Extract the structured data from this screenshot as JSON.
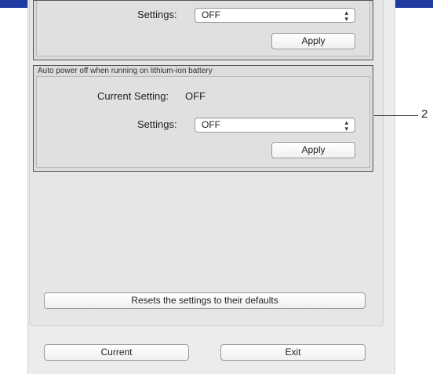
{
  "group1": {
    "settings_label": "Settings:",
    "settings_value": "OFF",
    "apply_label": "Apply"
  },
  "group2": {
    "title": "Auto power off when running on lithium-ion battery",
    "current_setting_label": "Current Setting:",
    "current_setting_value": "OFF",
    "settings_label": "Settings:",
    "settings_value": "OFF",
    "apply_label": "Apply"
  },
  "reset_button_label": "Resets the settings to their defaults",
  "footer": {
    "current_label": "Current",
    "exit_label": "Exit"
  },
  "callout": "2",
  "colors": {
    "title_bar": "#1f3aa0",
    "group_border": "#555555"
  }
}
